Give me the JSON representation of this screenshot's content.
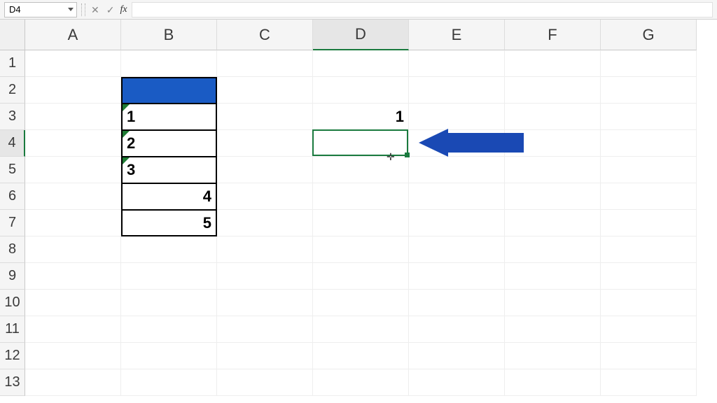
{
  "nameBox": "D4",
  "formulaBar": {
    "value": "",
    "cancelGlyph": "✕",
    "enterGlyph": "✓",
    "fxLabel": "fx"
  },
  "columns": [
    "A",
    "B",
    "C",
    "D",
    "E",
    "F",
    "G"
  ],
  "rows": [
    "1",
    "2",
    "3",
    "4",
    "5",
    "6",
    "7",
    "8",
    "9",
    "10",
    "11",
    "12",
    "13"
  ],
  "selected": {
    "col": "D",
    "row": "4"
  },
  "cells": {
    "B2": {
      "value": "",
      "fill": "#1a5bc4"
    },
    "B3": {
      "value": "1",
      "align": "left",
      "textAsNumberWarning": true
    },
    "B4": {
      "value": "2",
      "align": "left",
      "textAsNumberWarning": true
    },
    "B5": {
      "value": "3",
      "align": "left",
      "textAsNumberWarning": true
    },
    "B6": {
      "value": "4",
      "align": "right"
    },
    "B7": {
      "value": "5",
      "align": "right"
    },
    "D3": {
      "value": "1",
      "align": "right"
    }
  },
  "annotation": {
    "arrowPointsAt": "D3"
  },
  "cursorGlyph": "✛"
}
